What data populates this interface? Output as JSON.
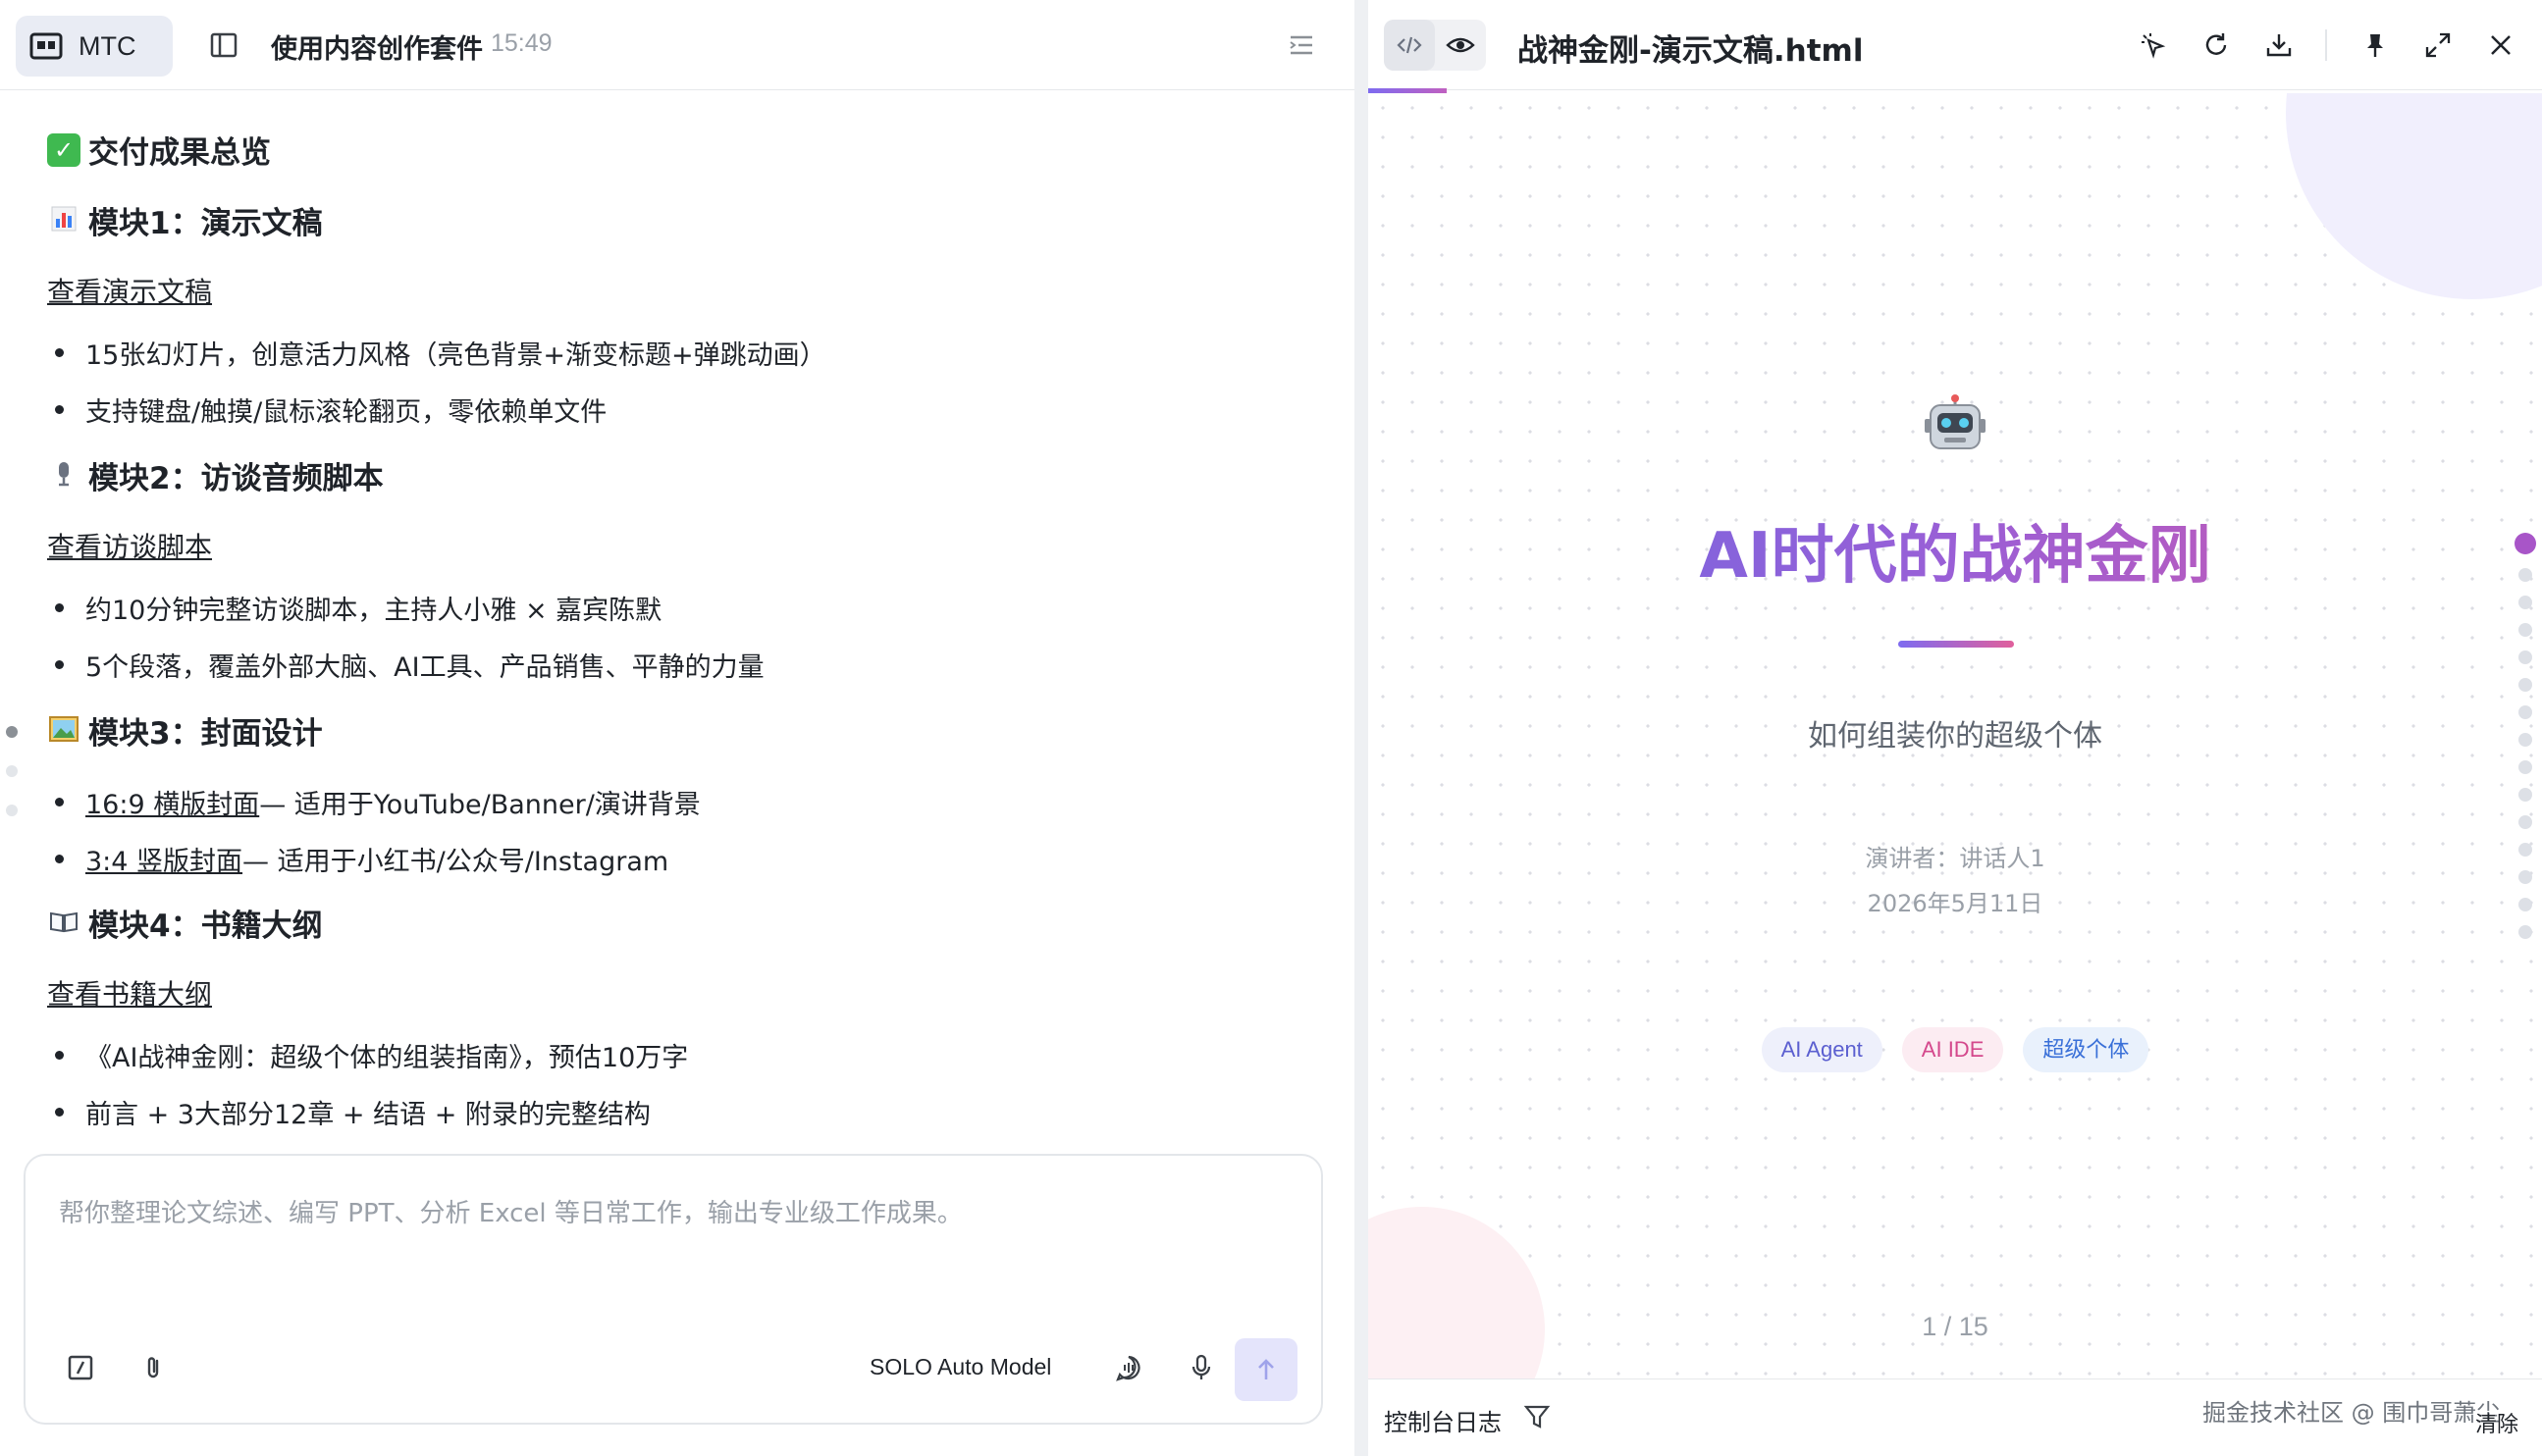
{
  "left_panel": {
    "tab_label": "MTC",
    "title": "使用内容创作套件",
    "time": "15:49",
    "summary_heading": "交付成果总览",
    "modules": [
      {
        "heading": "模块1：演示文稿",
        "link": "查看演示文稿",
        "bullets": [
          "15张幻灯片，创意活力风格（亮色背景+渐变标题+弹跳动画）",
          "支持键盘/触摸/鼠标滚轮翻页，零依赖单文件"
        ]
      },
      {
        "heading": "模块2：访谈音频脚本",
        "link": "查看访谈脚本",
        "bullets": [
          "约10分钟完整访谈脚本，主持人小雅 × 嘉宾陈默",
          "5个段落，覆盖外部大脑、AI工具、产品销售、平静的力量"
        ]
      },
      {
        "heading": "模块3：封面设计",
        "bullet_links": [
          {
            "link": "16:9 横版封面",
            "text": " — 适用于YouTube/Banner/演讲背景"
          },
          {
            "link": "3:4 竖版封面",
            "text": " — 适用于小红书/公众号/Instagram"
          }
        ]
      },
      {
        "heading": "模块4：书籍大纲",
        "link": "查看书籍大纲",
        "bullets": [
          "《AI战神金刚：超级个体的组装指南》，预估10万字",
          "前言 + 3大部分12章 + 结语 + 附录的完整结构"
        ]
      }
    ],
    "input": {
      "placeholder": "帮你整理论文综述、编写 PPT、分析 Excel 等日常工作，输出专业级工作成果。",
      "model": "SOLO Auto Model"
    }
  },
  "right_panel": {
    "file_name": "战神金刚-演示文稿.html",
    "slide": {
      "title": "AI时代的战神金刚",
      "subtitle": "如何组装你的超级个体",
      "speaker": "演讲者：讲话人1",
      "date": "2026年5月11日",
      "tags": [
        "AI Agent",
        "AI IDE",
        "超级个体"
      ],
      "page": "1 / 15",
      "current_slide": 1,
      "total_slides": 15
    },
    "console": {
      "label": "控制台日志",
      "watermark": "掘金技术社区 @ 围巾哥萧尘",
      "clear": "清除"
    }
  },
  "colors": {
    "accent": "#7e6bf0",
    "title_gradient_start": "#6b69e3",
    "title_gradient_end": "#d457a8",
    "send_button": "#e4e4fb"
  },
  "icons": {
    "summary": "check-mark-icon",
    "module1": "bar-chart-icon",
    "module2": "microphone-icon",
    "module3": "picture-icon",
    "module4": "open-book-icon",
    "slide_hero": "robot-icon"
  }
}
